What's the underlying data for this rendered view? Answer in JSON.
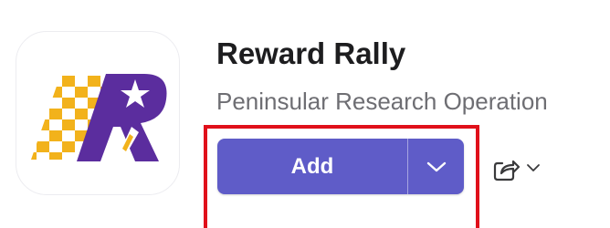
{
  "app": {
    "title": "Reward Rally",
    "publisher": "Peninsular Research Operation",
    "icon": "reward-rally-logo"
  },
  "actions": {
    "add_label": "Add",
    "add_menu_icon": "chevron-down-icon",
    "share_icon": "share-icon",
    "share_menu_icon": "chevron-down-icon"
  },
  "colors": {
    "add_button": "#5f5cc8",
    "highlight": "#e0101a",
    "logo_purple": "#5b2d9e",
    "logo_gold": "#f2b21b"
  }
}
